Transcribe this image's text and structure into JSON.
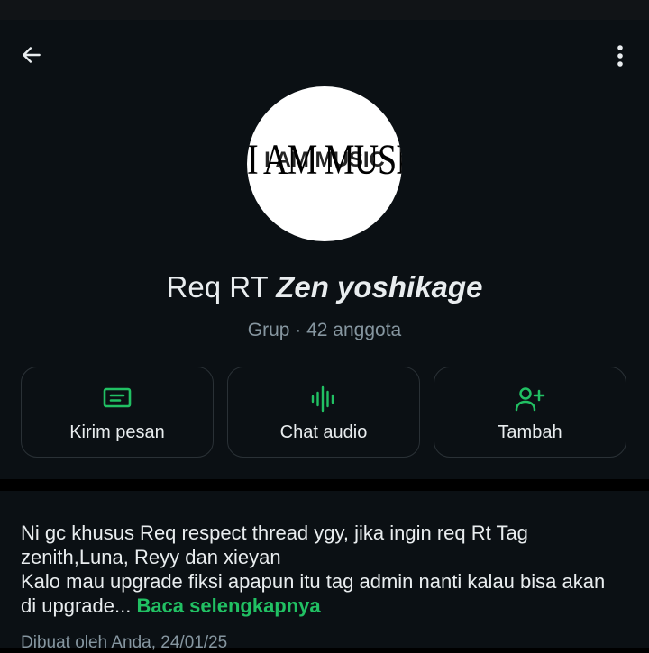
{
  "header": {
    "back_icon": "arrow-left-icon",
    "menu_icon": "more-vertical-icon"
  },
  "avatar": {
    "logo_text": "I AM MUSIC"
  },
  "group": {
    "name_prefix": "Req RT ",
    "name_emphasis": "Zen yoshikage",
    "meta": "Grup · 42 anggota"
  },
  "actions": [
    {
      "label": "Kirim pesan",
      "icon": "message-icon"
    },
    {
      "label": "Chat audio",
      "icon": "audio-wave-icon"
    },
    {
      "label": "Tambah",
      "icon": "add-person-icon"
    }
  ],
  "description": {
    "line1": "Ni gc khusus Req respect thread ygy, jika ingin req Rt Tag zenith,Luna, Reyy dan xieyan",
    "line2": "Kalo mau upgrade fiksi apapun itu tag admin nanti kalau bisa akan di upgrade... ",
    "read_more": "Baca selengkapnya",
    "created": "Dibuat oleh Anda, 24/01/25"
  },
  "colors": {
    "background": "#0b1014",
    "accent_green": "#21c063",
    "text_primary": "#e9edef",
    "text_secondary": "#8696a0",
    "button_border": "#2a3136"
  }
}
